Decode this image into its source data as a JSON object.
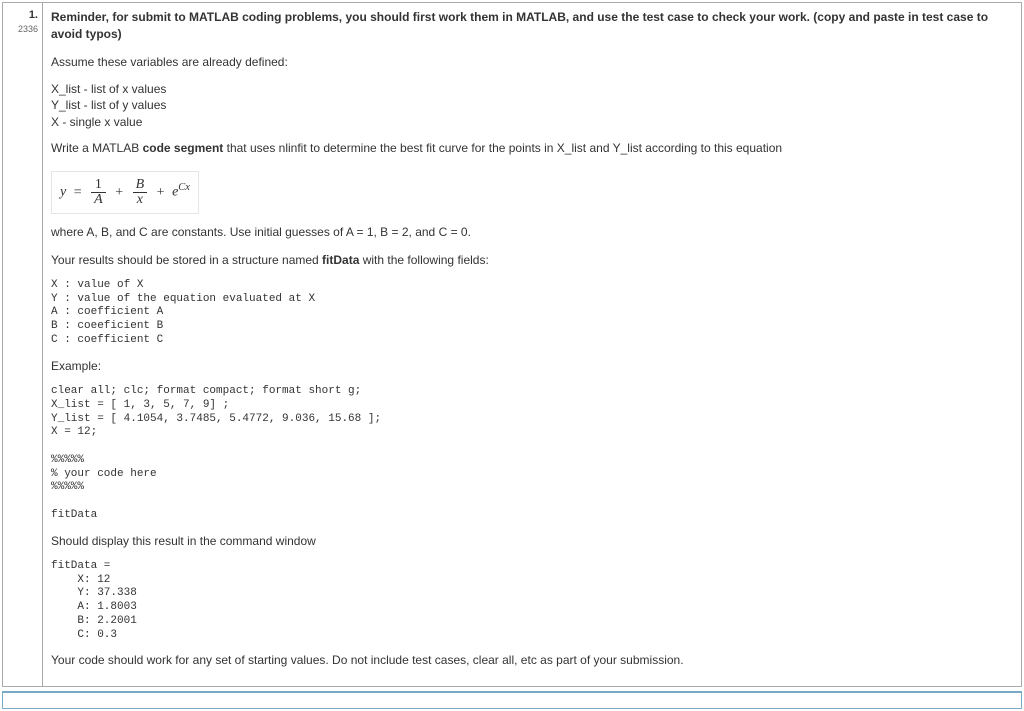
{
  "question": {
    "number": "1.",
    "points": "2336",
    "reminder_bold": "Reminder, for submit to MATLAB coding problems, you should first work them in MATLAB, and use the test case to check your work. (copy and paste in test case to avoid typos)",
    "assume": "Assume these variables are already defined:",
    "vars": "X_list - list of x values\nY_list - list of y values\nX - single x value",
    "write_prefix": "Write a MATLAB ",
    "write_bold": "code segment",
    "write_suffix": " that uses nlinfit to determine the best fit curve for the points in X_list and Y_list according to this equation",
    "eq": {
      "y": "y",
      "eq_sign": "=",
      "one": "1",
      "A": "A",
      "plus1": "+",
      "B": "B",
      "x": "x",
      "plus2": "+",
      "e": "e",
      "Cx": "Cx"
    },
    "where": "where A, B, and C are constants. Use initial guesses of A = 1, B = 2, and C = 0.",
    "results_prefix": "Your results should be stored in a structure named ",
    "results_bold": "fitData",
    "results_suffix": " with the following fields:",
    "fields": "X : value of X\nY : value of the equation evaluated at X\nA : coefficient A\nB : coeeficient B\nC : coefficient C",
    "example_label": "Example:",
    "example_code": "clear all; clc; format compact; format short g;\nX_list = [ 1, 3, 5, 7, 9] ;\nY_list = [ 4.1054, 3.7485, 5.4772, 9.036, 15.68 ];\nX = 12;\n\n%%%%%\n% your code here\n%%%%%\n\nfitData",
    "should_display": "Should display this result in the command window",
    "output": "fitData = \n    X: 12\n    Y: 37.338\n    A: 1.8003\n    B: 2.2001\n    C: 0.3",
    "footer": "Your code should work for any set of starting values. Do not include test cases, clear all, etc as part of your submission."
  }
}
